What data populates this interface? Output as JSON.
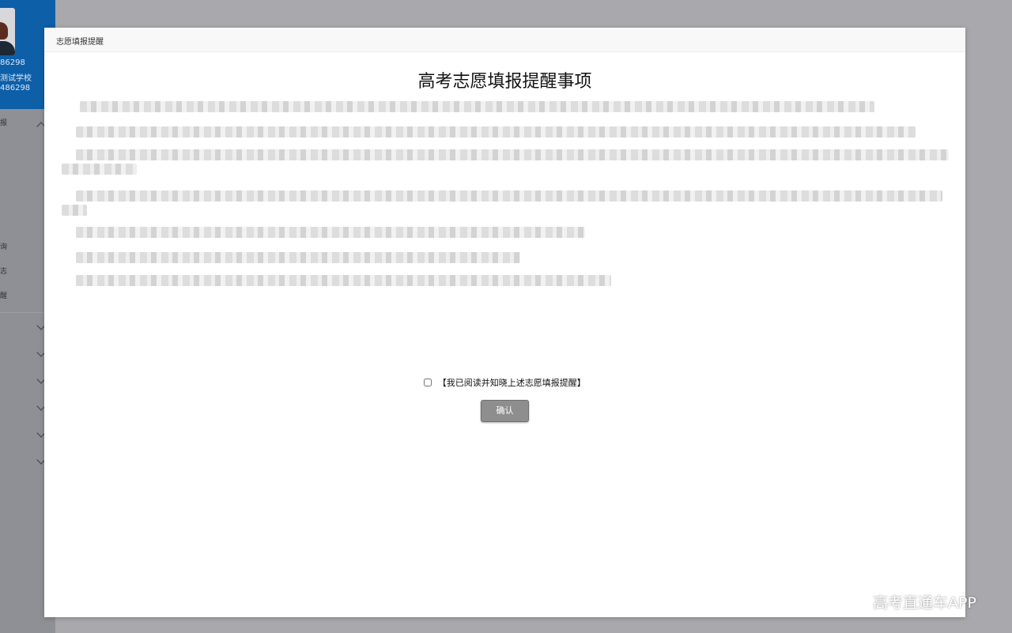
{
  "sidebar": {
    "profile": {
      "id_fragment": "86298",
      "school_fragment": "测试学校",
      "account_fragment": "486298"
    },
    "items": [
      {
        "label": "报"
      },
      {
        "label": "询"
      },
      {
        "label": "志"
      },
      {
        "label": "醒"
      }
    ]
  },
  "modal": {
    "header_title": "志愿填报提醒",
    "title": "高考志愿填报提醒事项",
    "agree_label": "【我已阅读并知晓上述志愿填报提醒】",
    "confirm_label": "确认"
  },
  "watermark": "高考直通车APP"
}
